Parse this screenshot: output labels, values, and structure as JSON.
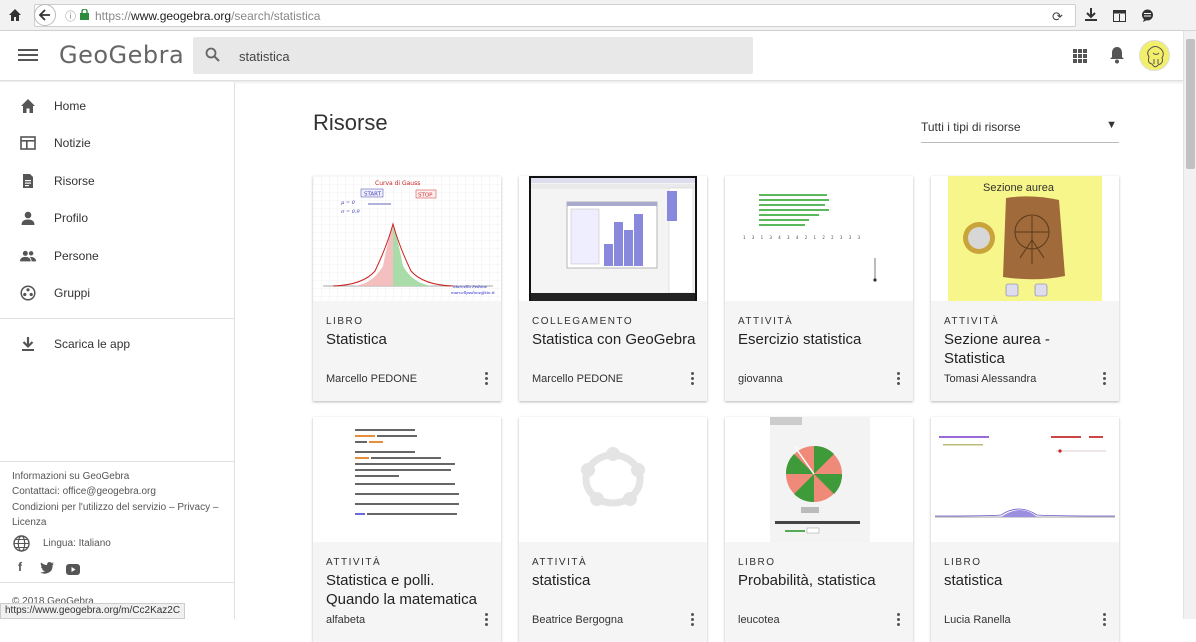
{
  "browser": {
    "url_prefix": "https://",
    "url_host": "www.geogebra.org",
    "url_path": "/search/statistica"
  },
  "header": {
    "logo": "GeoGebra",
    "search_value": "statistica"
  },
  "sidebar": {
    "items": [
      {
        "label": "Home",
        "icon": "home-icon"
      },
      {
        "label": "Notizie",
        "icon": "news-icon"
      },
      {
        "label": "Risorse",
        "icon": "document-icon"
      },
      {
        "label": "Profilo",
        "icon": "person-icon"
      },
      {
        "label": "Persone",
        "icon": "people-icon"
      },
      {
        "label": "Gruppi",
        "icon": "groups-icon"
      }
    ],
    "download_label": "Scarica le app",
    "footer": {
      "info": "Informazioni su GeoGebra",
      "contact": "Contattaci: office@geogebra.org",
      "terms_line1": "Condizioni per l'utilizzo del servizio – Privacy –",
      "terms_line2": "Licenza",
      "language": "Lingua: Italiano",
      "copyright": "© 2018 GeoGebra"
    }
  },
  "main": {
    "title": "Risorse",
    "filter_label": "Tutti i tipi di risorse",
    "cards": [
      {
        "type": "LIBRO",
        "title": "Statistica",
        "author": "Marcello PEDONE",
        "thumb": "bell-curve"
      },
      {
        "type": "COLLEGAMENTO",
        "title": "Statistica con GeoGebra",
        "author": "Marcello PEDONE",
        "thumb": "screenshot"
      },
      {
        "type": "ATTIVITÀ",
        "title": "Esercizio statistica",
        "author": "giovanna",
        "thumb": "green-text"
      },
      {
        "type": "ATTIVITÀ",
        "title": "Sezione aurea - Statistica",
        "author": "Tomasi Alessandra",
        "thumb": "golden"
      },
      {
        "type": "ATTIVITÀ",
        "title": "Statistica e polli. Quando la matematica",
        "author": "alfabeta",
        "thumb": "formula"
      },
      {
        "type": "ATTIVITÀ",
        "title": "statistica",
        "author": "Beatrice Bergogna",
        "thumb": "placeholder"
      },
      {
        "type": "LIBRO",
        "title": "Probabilità, statistica",
        "author": "leucotea",
        "thumb": "pie"
      },
      {
        "type": "LIBRO",
        "title": "statistica",
        "author": "Lucia Ranella",
        "thumb": "distribution"
      }
    ]
  },
  "status_url": "https://www.geogebra.org/m/Cc2Kaz2C",
  "colors": {
    "accent": "#666666",
    "card_body": "#f5f5f5",
    "avatar_bg": "#f3ef6a"
  }
}
